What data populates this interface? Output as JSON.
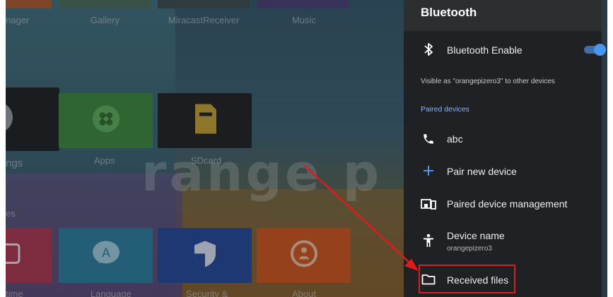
{
  "launcher": {
    "top_labels": [
      "nager",
      "Gallery",
      "MiracastReceiver",
      "Music"
    ],
    "middle_labels": [
      "ngs",
      "Apps",
      "SDcard"
    ],
    "section_label": "es",
    "bottom_labels": [
      "time",
      "Language",
      "Security &",
      "About"
    ],
    "brand_text": "range p"
  },
  "bluetooth_panel": {
    "title": "Bluetooth",
    "enable_label": "Bluetooth Enable",
    "enable_state": true,
    "visibility_text": "Visible as \"orangepizero3\" to other devices",
    "paired_section": "Paired devices",
    "paired_device": "abc",
    "pair_new": "Pair new device",
    "paired_management": "Paired device management",
    "device_name_label": "Device name",
    "device_name_value": "orangepizero3",
    "received_files": "Received files"
  },
  "colors": {
    "panel_bg": "#202124",
    "accent": "#4a97f2",
    "section_blue": "#8ab4f8",
    "annotation_red": "#e01b1b"
  },
  "icons": {
    "bluetooth": "bluetooth-icon",
    "phone": "phone-icon",
    "plus": "plus-icon",
    "devices": "devices-icon",
    "accessibility": "person-icon",
    "folder": "folder-icon"
  }
}
